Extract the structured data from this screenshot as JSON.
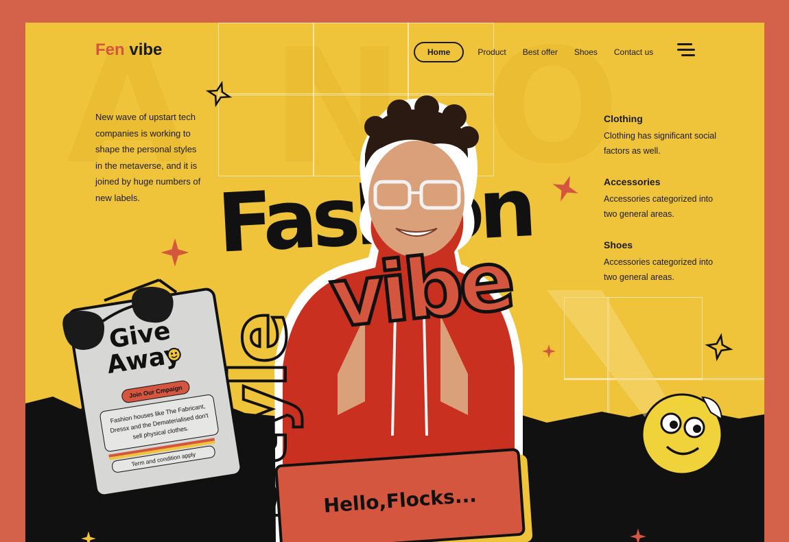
{
  "brand": {
    "logo_accent": "Fen",
    "logo_rest": " vibe"
  },
  "nav": {
    "home": "Home",
    "product": "Product",
    "best_offer": "Best offer",
    "shoes": "Shoes",
    "contact": "Contact us",
    "menu_icon": "menu-icon"
  },
  "intro_text": "New wave of upstart tech companies is working to shape the personal styles in the metaverse, and it is joined by huge numbers of  new labels.",
  "features": [
    {
      "title": "Clothing",
      "text": "Clothing has significant social factors as well."
    },
    {
      "title": "Accessories",
      "text": "Accessories categorized into two general areas."
    },
    {
      "title": "Shoes",
      "text": "Accessories categorized into two general areas."
    }
  ],
  "hero": {
    "word_fashion": "Fashion",
    "word_vibe": "vibe",
    "word_style": "Style"
  },
  "giveaway": {
    "line1": "Give",
    "line2": "Away",
    "join_button": "Join Our Cmpaign",
    "description": "Fashion houses like The Fabricant, Dressx and the Dematerialised don't sell physical clothes.",
    "terms": "Term and  condition apply"
  },
  "cta": {
    "hello": "Hello,Flocks..."
  },
  "colors": {
    "background": "#f0c43a",
    "accent": "#d4563e",
    "border": "#d4624a",
    "ink": "#111111"
  }
}
